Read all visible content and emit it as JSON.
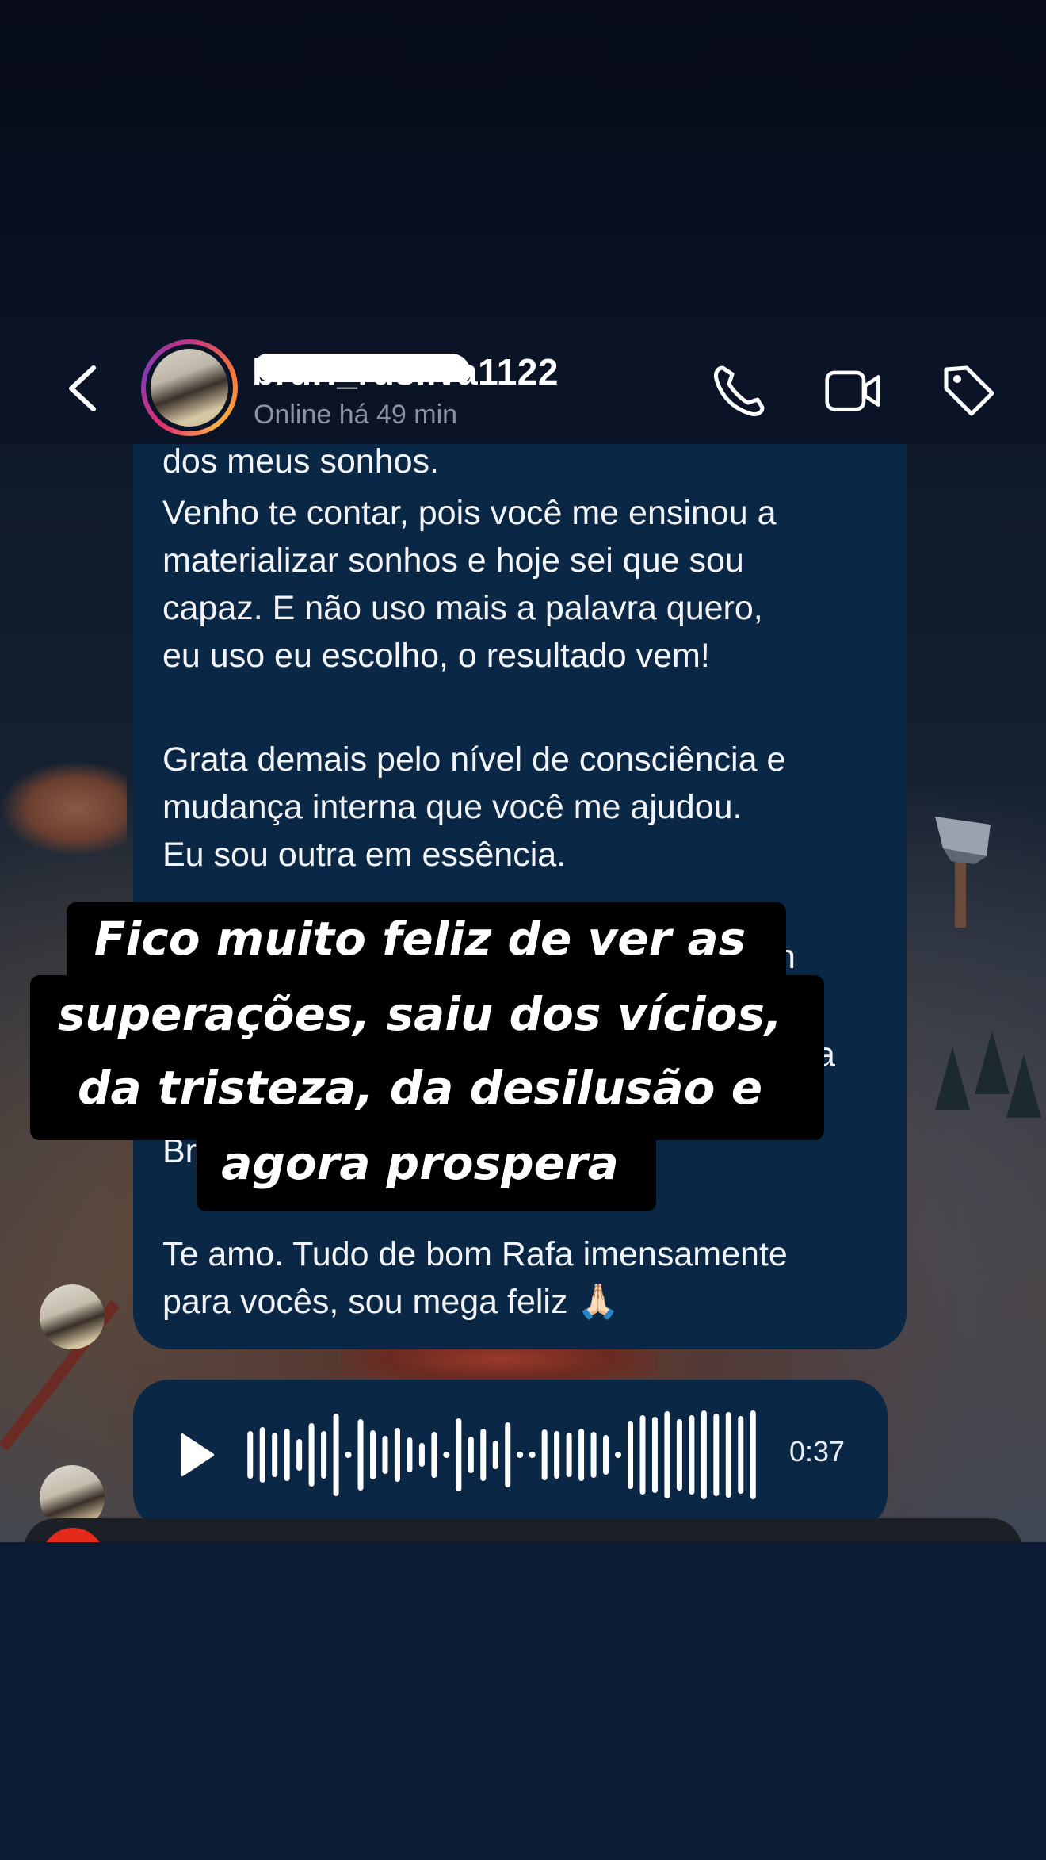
{
  "header": {
    "username": "bruri_rusilva1122",
    "status": "Online há 49 min",
    "icons": [
      "chevron-left-icon",
      "phone-icon",
      "video-camera-icon",
      "tag-icon"
    ]
  },
  "message": {
    "lines": [
      "dos meus sonhos.",
      "Venho te contar, pois você me ensinou a",
      "materializar sonhos e hoje sei que sou",
      "capaz.  E não uso mais a palavra quero,",
      "eu uso eu escolho, o resultado vem!",
      "Grata demais pelo nível de consciência e",
      "mudança interna que você me ajudou.",
      "Eu sou outra em essência.",
      "Te amo. Tudo de bom Rafa imensamente",
      "para vocês, sou mega feliz 🙏🏻"
    ],
    "partial_fragments": [
      "n",
      "a",
      "Br"
    ]
  },
  "audio": {
    "duration": "0:37",
    "icon": "play-icon"
  },
  "caption": {
    "lines": [
      "Fico muito feliz de ver as",
      "superações, saiu dos vícios,",
      "da tristeza, da desilusão e",
      "agora prospera"
    ]
  },
  "colors": {
    "bubble": "#0b2746",
    "header": "#0a1426",
    "text": "#f2f4f7",
    "muted": "#8a93a3",
    "caption_bg": "#000000"
  }
}
